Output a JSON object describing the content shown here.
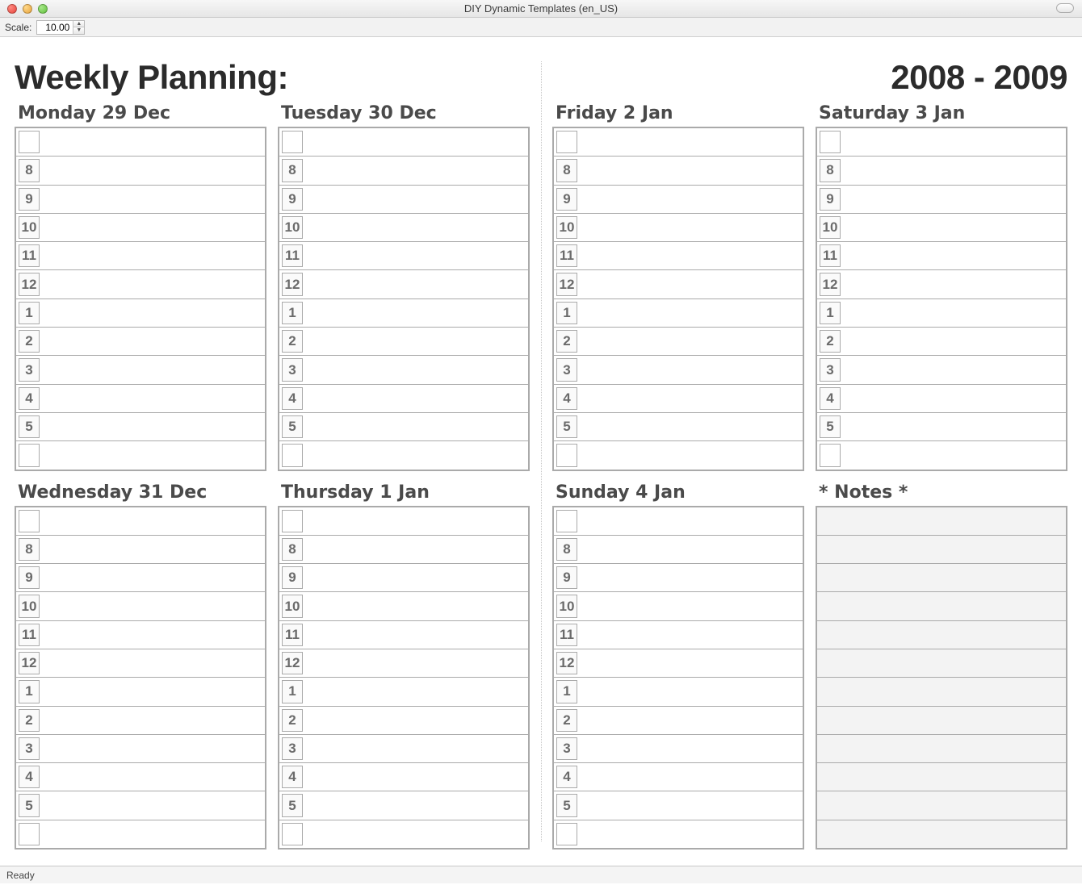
{
  "window": {
    "title": "DIY Dynamic Templates (en_US)"
  },
  "toolbar": {
    "scale_label": "Scale:",
    "scale_value": "10.00"
  },
  "planner": {
    "title_left": "Weekly Planning:",
    "title_right": "2008 - 2009",
    "hours": [
      "",
      "8",
      "9",
      "10",
      "11",
      "12",
      "1",
      "2",
      "3",
      "4",
      "5",
      ""
    ],
    "left_days": [
      {
        "label": "Monday 29 Dec"
      },
      {
        "label": "Tuesday 30 Dec"
      },
      {
        "label": "Wednesday 31 Dec"
      },
      {
        "label": "Thursday 1 Jan"
      }
    ],
    "right_days": [
      {
        "label": "Friday 2 Jan"
      },
      {
        "label": "Saturday 3 Jan"
      },
      {
        "label": "Sunday 4 Jan"
      }
    ],
    "notes_label": "* Notes *",
    "notes_rows": 12
  },
  "status": {
    "text": "Ready"
  }
}
